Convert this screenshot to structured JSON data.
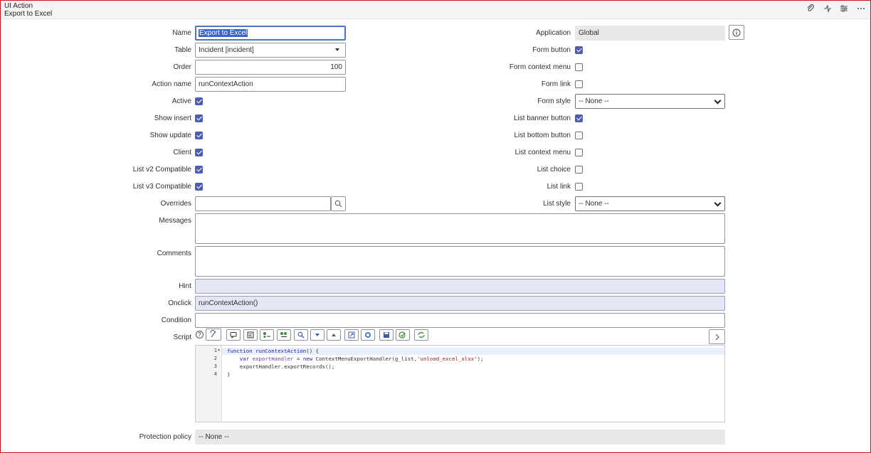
{
  "header": {
    "record_type": "UI Action",
    "record_name": "Export to Excel"
  },
  "left": {
    "name": {
      "label": "Name",
      "value": "Export to Excel"
    },
    "table": {
      "label": "Table",
      "value": "Incident [incident]"
    },
    "order": {
      "label": "Order",
      "value": "100"
    },
    "action_name": {
      "label": "Action name",
      "value": "runContextAction"
    },
    "active": {
      "label": "Active"
    },
    "show_insert": {
      "label": "Show insert"
    },
    "show_update": {
      "label": "Show update"
    },
    "client": {
      "label": "Client"
    },
    "list_v2": {
      "label": "List v2 Compatible"
    },
    "list_v3": {
      "label": "List v3 Compatible"
    },
    "overrides": {
      "label": "Overrides",
      "value": ""
    }
  },
  "right": {
    "application": {
      "label": "Application",
      "value": "Global"
    },
    "form_button": {
      "label": "Form button"
    },
    "form_context_menu": {
      "label": "Form context menu"
    },
    "form_link": {
      "label": "Form link"
    },
    "form_style": {
      "label": "Form style",
      "value": "-- None --"
    },
    "list_banner_button": {
      "label": "List banner button"
    },
    "list_bottom_button": {
      "label": "List bottom button"
    },
    "list_context_menu": {
      "label": "List context menu"
    },
    "list_choice": {
      "label": "List choice"
    },
    "list_link": {
      "label": "List link"
    },
    "list_style": {
      "label": "List style",
      "value": "-- None --"
    }
  },
  "wide": {
    "messages": {
      "label": "Messages"
    },
    "comments": {
      "label": "Comments"
    },
    "hint": {
      "label": "Hint",
      "value": ""
    },
    "onclick": {
      "label": "Onclick",
      "value": "runContextAction()"
    },
    "condition": {
      "label": "Condition",
      "value": ""
    },
    "script": {
      "label": "Script"
    },
    "protection": {
      "label": "Protection policy",
      "value": "-- None --"
    }
  },
  "editor": {
    "line_numbers": [
      "1",
      "2",
      "3",
      "4"
    ],
    "line1": {
      "kw": "function",
      "fn": "runContextAction",
      "rest": "() {"
    },
    "line2": {
      "indent": "    ",
      "kw": "var",
      "var": "exportHandler",
      "mid": " = ",
      "kw2": "new",
      "call": " ContextMenuExportHandler(g_list,",
      "str": "'unload_excel_xlsx'",
      "end": ");"
    },
    "line3": "    exportHandler.exportRecords();",
    "line4": "}"
  },
  "icons": {
    "attachment": "paperclip-icon",
    "activity": "activity-icon",
    "personalize": "sliders-icon",
    "more": "more-options-icon"
  },
  "colors": {
    "checkbox_on": "#4f5ea8",
    "focus_border": "#4a74c9",
    "frame_border": "#c4161c",
    "hint_bg": "#e5e6f4"
  }
}
